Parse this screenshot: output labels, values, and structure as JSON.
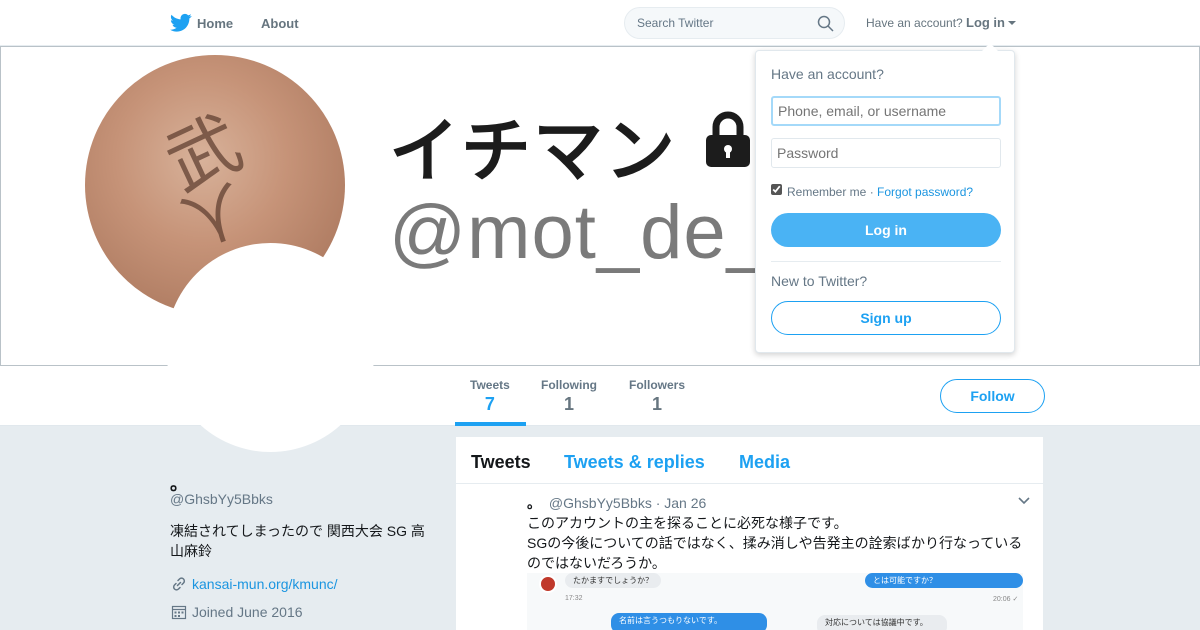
{
  "nav": {
    "home": "Home",
    "about": "About",
    "search_placeholder": "Search Twitter",
    "have_account": "Have an account?",
    "login": "Log in"
  },
  "banner": {
    "name_text": "イチマン",
    "handle_text": "@mot_de_r",
    "photo_chars": [
      "武",
      "人"
    ]
  },
  "stats": [
    {
      "label": "Tweets",
      "value": "7"
    },
    {
      "label": "Following",
      "value": "1"
    },
    {
      "label": "Followers",
      "value": "1"
    }
  ],
  "follow_label": "Follow",
  "profile": {
    "name": "。",
    "handle": "@GhsbYy5Bbks",
    "bio": "凍結されてしまったので 関西大会 SG 高山麻鈴",
    "link": "kansai-mun.org/kmunc/",
    "joined": "Joined June 2016"
  },
  "timeline": {
    "tabs": [
      "Tweets",
      "Tweets & replies",
      "Media"
    ],
    "tweet": {
      "name": "。",
      "handle": "@GhsbYy5Bbks",
      "date": "· Jan 26",
      "lines": [
        "このアカウントの主を探ることに必死な様子です。",
        "SGの今後についての話ではなく、揉み消しや告発主の詮索ばかり行なっているのではないだろうか。"
      ],
      "media": {
        "bubbles": [
          "たかますでしょうか？",
          "とは可能ですか？",
          "名前は言うつもりないです。",
          "対応については協議中です。"
        ],
        "times": [
          "17:32",
          "20:06 ✓"
        ]
      }
    }
  },
  "login_dropdown": {
    "title": "Have an account?",
    "username_placeholder": "Phone, email, or username",
    "password_placeholder": "Password",
    "remember": "Remember me",
    "separator": " · ",
    "forgot": "Forgot password?",
    "login_button": "Log in",
    "new_to": "New to Twitter?",
    "signup_button": "Sign up"
  },
  "colors": {
    "accent": "#1da1f2",
    "login_button": "#4ab3f4",
    "background": "#e6ecf0"
  }
}
